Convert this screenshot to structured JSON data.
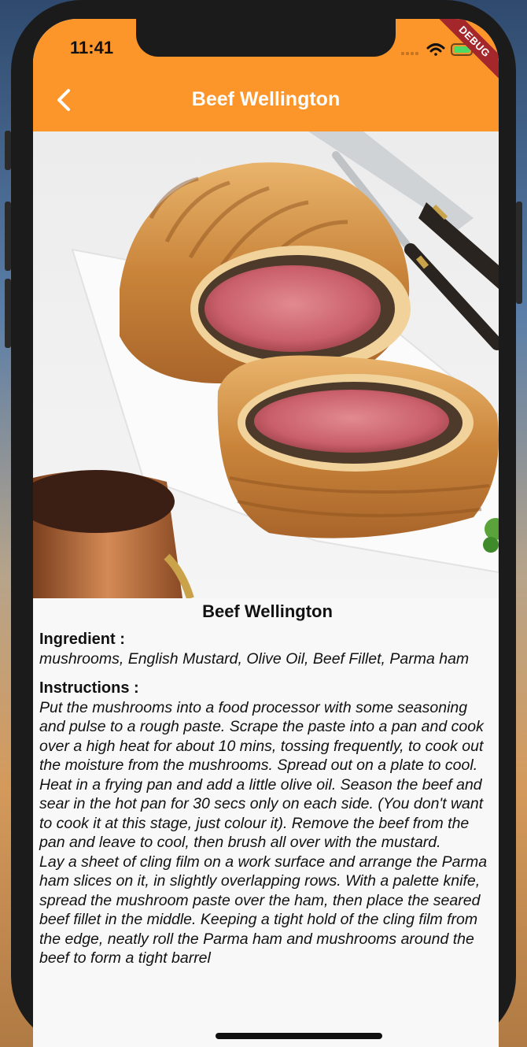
{
  "status_bar": {
    "time": "11:41",
    "debug_banner": "DEBUG"
  },
  "appbar": {
    "title": "Beef Wellington",
    "back_icon": "chevron-left-icon"
  },
  "hero_image": {
    "description": "beef-wellington-photo"
  },
  "recipe": {
    "title": "Beef Wellington",
    "ingredients_label": "Ingredient :",
    "ingredients_text": "mushrooms, English Mustard, Olive Oil, Beef Fillet, Parma ham",
    "instructions_label": "Instructions :",
    "instructions_text": "Put the mushrooms into a food processor with some seasoning and pulse to a rough paste. Scrape the paste into a pan and cook over a high heat for about 10 mins, tossing frequently, to cook out the moisture from the mushrooms. Spread out on a plate to cool.\nHeat in a frying pan and add a little olive oil. Season the beef and sear in the hot pan for 30 secs only on each side. (You don't want to cook it at this stage, just colour it). Remove the beef from the pan and leave to cool, then brush all over with the mustard.\nLay a sheet of cling film on a work surface and arrange the Parma ham slices on it, in slightly overlapping rows. With a palette knife, spread the mushroom paste over the ham, then place the seared beef fillet in the middle. Keeping a tight hold of the cling film from the edge, neatly roll the Parma ham and mushrooms around the beef to form a tight barrel"
  },
  "colors": {
    "appbar": "#fc962b",
    "debug": "#a3272b",
    "background": "#f8f8f8"
  }
}
